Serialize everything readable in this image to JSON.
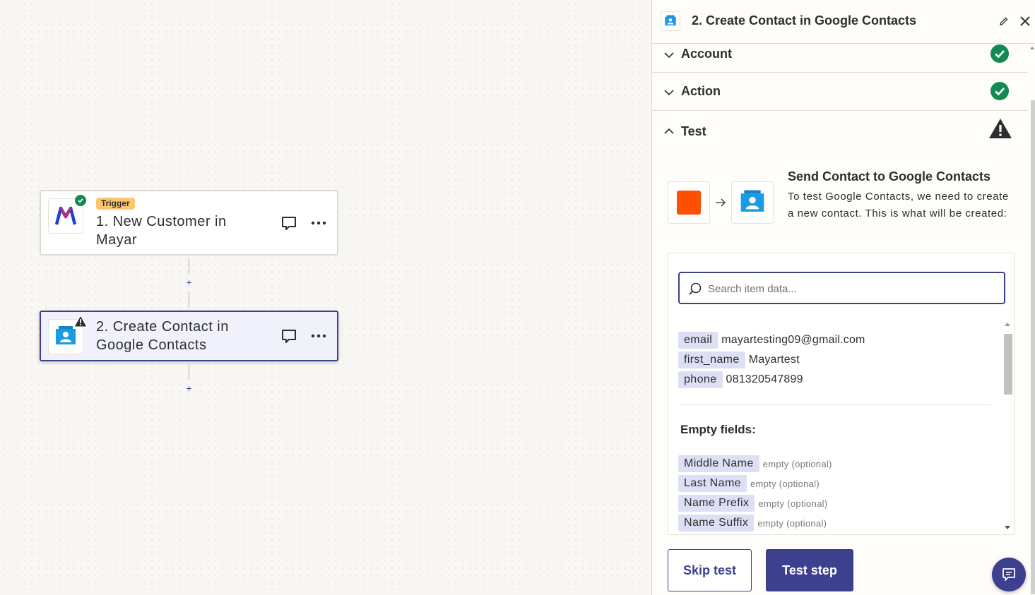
{
  "canvas": {
    "trigger_step": {
      "tag": "Trigger",
      "title": "1. New Customer in Mayar",
      "app_icon": "mayar-logo-icon",
      "status": "complete"
    },
    "action_step": {
      "title": "2. Create Contact in Google Contacts",
      "app_icon": "google-contacts-icon",
      "status": "warning"
    },
    "add_step_label": "+"
  },
  "panel": {
    "title": "2. Create Contact in Google Contacts",
    "sections": {
      "account": {
        "label": "Account",
        "status": "complete"
      },
      "action": {
        "label": "Action",
        "status": "complete"
      },
      "test": {
        "label": "Test",
        "status": "warning"
      }
    },
    "test": {
      "heading": "Send Contact to Google Contacts",
      "description": "To test Google Contacts, we need to create a new contact. This is what will be created:",
      "search_placeholder": "Search item data...",
      "fields": [
        {
          "key": "email",
          "value": "mayartesting09@gmail.com"
        },
        {
          "key": "first_name",
          "value": "Mayartest"
        },
        {
          "key": "phone",
          "value": "081320547899"
        }
      ],
      "empty_heading": "Empty fields:",
      "empty_fields": [
        {
          "key": "Middle Name",
          "value": "empty (optional)"
        },
        {
          "key": "Last Name",
          "value": "empty (optional)"
        },
        {
          "key": "Name Prefix",
          "value": "empty (optional)"
        },
        {
          "key": "Name Suffix",
          "value": "empty (optional)"
        }
      ]
    },
    "buttons": {
      "skip": "Skip test",
      "test": "Test step"
    }
  },
  "colors": {
    "accent": "#3d3f8f",
    "success": "#138a52",
    "trigger_tag": "#ffc56e",
    "source_app": "#ff4f00",
    "contacts_blue": "#1a9be6"
  }
}
